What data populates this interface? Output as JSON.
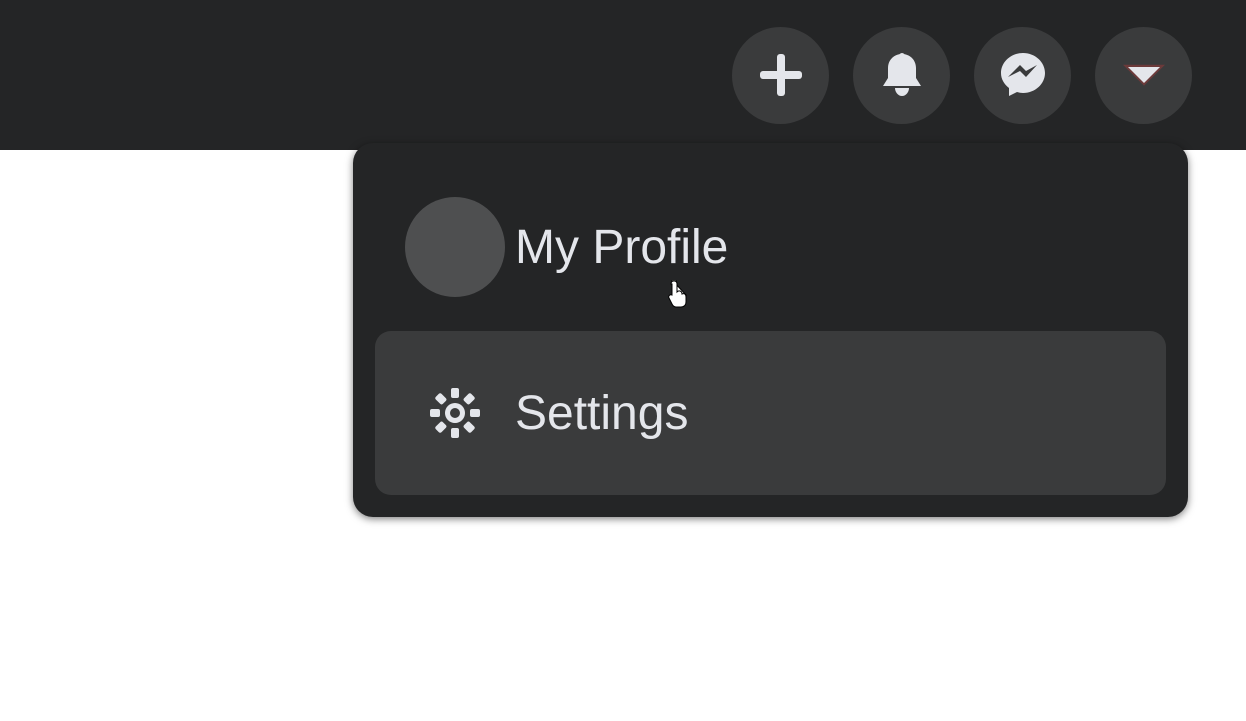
{
  "topbar": {
    "create": "create",
    "notifications": "notifications",
    "messenger": "messenger",
    "account": "account"
  },
  "dropdown": {
    "profile_label": "My Profile",
    "settings_label": "Settings"
  }
}
